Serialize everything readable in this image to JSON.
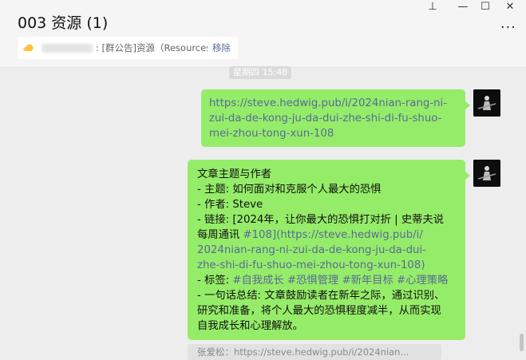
{
  "header": {
    "title": "003 资源 (1)",
    "pin_icon": "pin-icon",
    "minimize_icon": "minimize-icon",
    "maximize_icon": "maximize-icon",
    "close_icon": "close-icon",
    "more_icon": "more-icon",
    "pin_glyph": "⊥",
    "min_glyph": "—",
    "max_glyph": "☐",
    "close_glyph": "✕",
    "more_glyph": "···"
  },
  "pinned": {
    "icon": "sun-icon",
    "text": ": [群公告]资源（Resources）...",
    "remove": "移除"
  },
  "time_label": "星期四 15:48",
  "messages": [
    {
      "lines": [
        "https://steve.hedwig.pub/i/2024nian-rang-ni-",
        "zui-da-de-kong-ju-da-dui-zhe-shi-di-fu-shuo-",
        "mei-zhou-tong-xun-108"
      ]
    },
    {
      "l1": "文章主题与作者",
      "l2": "- 主题: 如何面对和克服个人最大的恐惧",
      "l3": "- 作者: Steve",
      "l4": "- 链接: [2024年，让你最大的恐惧打对折 | 史蒂夫说",
      "l5a": "每周通讯 ",
      "l5b": "#108](https://steve.hedwig.pub/i/",
      "l6": "2024nian-rang-ni-zui-da-de-kong-ju-da-dui-",
      "l7": "zhe-shi-di-fu-shuo-mei-zhou-tong-xun-108)",
      "l8a": "- 标签: ",
      "l8b": "#自我成长 #恐惧管理 #新年目标 #心理策略",
      "l9": "- 一句话总结: 文章鼓励读者在新年之际，通过识别、",
      "l10": "研究和准备，将个人最大的恐惧程度减半，从而实现",
      "l11": "自我成长和心理解放。"
    }
  ],
  "quote_preview": "张爱松：https://steve.hedwig.pub/i/2024nian...",
  "colors": {
    "bubble": "#95ec69",
    "link": "#576b95",
    "background": "#ededed"
  }
}
